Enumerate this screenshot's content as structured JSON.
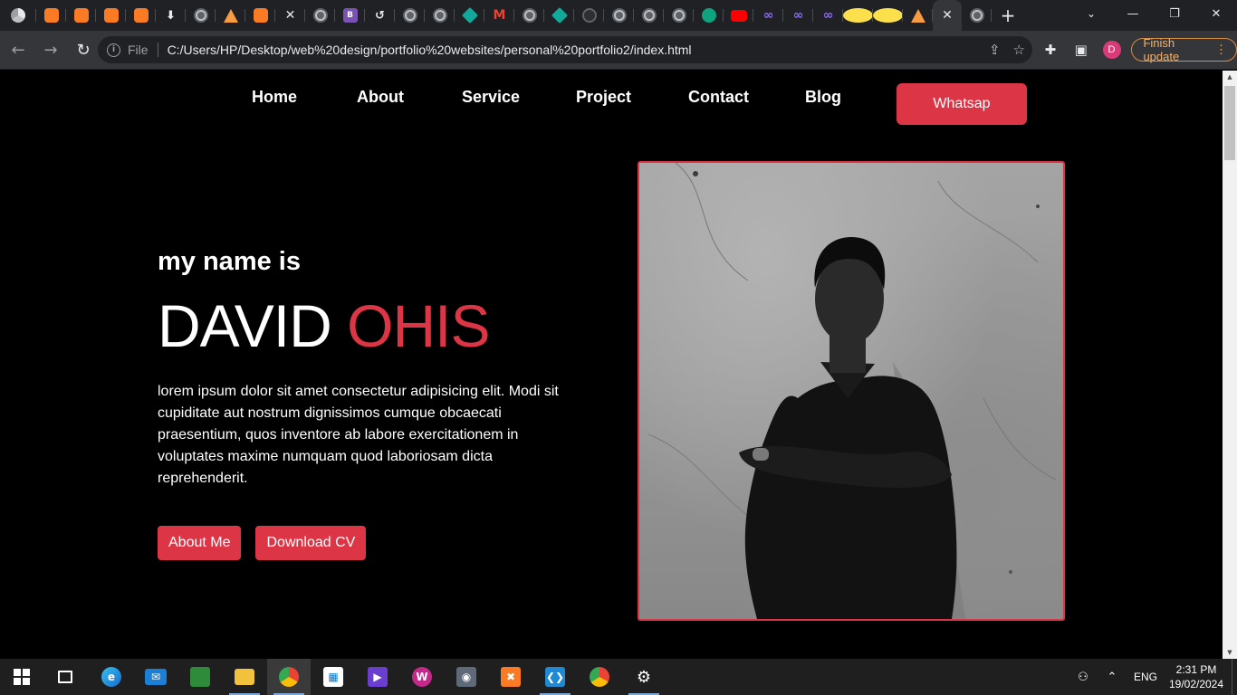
{
  "browser": {
    "tabs_favicons": [
      "chrome-icon",
      "xampp-icon",
      "xampp-icon",
      "xampp-icon",
      "xampp-icon",
      "download-icon",
      "globe-icon",
      "triangle-logo-icon",
      "xampp-icon",
      "x-icon",
      "globe-icon",
      "bootstrap-icon",
      "history-icon",
      "globe-icon",
      "globe-icon",
      "diamond-icon",
      "gmail-icon",
      "globe-icon",
      "diamond-icon",
      "github-icon",
      "globe-icon",
      "globe-icon",
      "globe-icon",
      "chatgpt-icon",
      "youtube-icon",
      "infinity-icon",
      "infinity-icon",
      "infinity-icon",
      "clock-icon",
      "clock-icon",
      "triangle-logo-icon"
    ],
    "bootstrap_label": "B",
    "active_tab_close": "✕",
    "new_tab": "+",
    "address": {
      "scheme_label": "File",
      "url": "C:/Users/HP/Desktop/web%20design/portfolio%20websites/personal%20portfolio2/index.html"
    },
    "profile_initial": "D",
    "update_button": "Finish update"
  },
  "site": {
    "nav": {
      "links": [
        "Home",
        "About",
        "Service",
        "Project",
        "Contact",
        "Blog"
      ],
      "cta": "Whatsap"
    },
    "hero": {
      "intro": "my name is",
      "first_name": "DAVID",
      "last_name": "OHIS",
      "bio": "lorem ipsum dolor sit amet consectetur adipisicing elit. Modi sit cupiditate aut nostrum dignissimos cumque obcaecati praesentium, quos inventore ab labore exercitationem in voluptates maxime numquam quod laboriosam dicta reprehenderit.",
      "buttons": [
        "About Me",
        "Download CV"
      ]
    },
    "portrait": "black-and-white photo of a man with crossed arms"
  },
  "taskbar": {
    "apps": [
      "windows-start-icon",
      "task-view-icon",
      "edge-icon",
      "mail-icon",
      "sheets-icon",
      "file-explorer-icon",
      "chrome-icon",
      "store-icon",
      "video-editor-icon",
      "wps-icon",
      "camera-icon",
      "xampp-icon",
      "vscode-icon",
      "chrome-dev-icon",
      "settings-icon"
    ],
    "language": "ENG",
    "time": "2:31 PM",
    "date": "19/02/2024"
  },
  "colors": {
    "accent": "#dc3545",
    "page_bg": "#000000",
    "chrome_dark": "#202124",
    "chrome_toolbar": "#35363a"
  }
}
